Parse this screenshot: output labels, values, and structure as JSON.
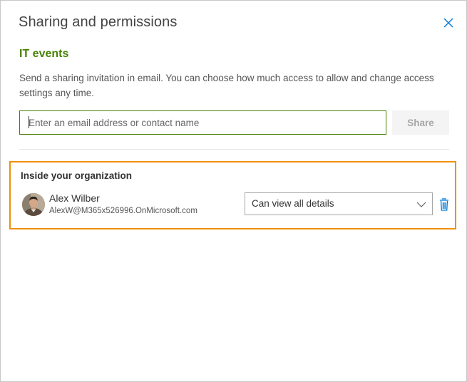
{
  "dialog": {
    "title": "Sharing and permissions",
    "close_icon": "close-icon"
  },
  "calendar": {
    "name": "IT events",
    "description": "Send a sharing invitation in email. You can choose how much access to allow and change access settings any time."
  },
  "invite": {
    "placeholder": "Enter an email address or contact name",
    "share_label": "Share"
  },
  "section": {
    "title": "Inside your organization",
    "highlight_color": "#f0900c"
  },
  "person": {
    "name": "Alex Wilber",
    "email": "AlexW@M365x526996.OnMicrosoft.com",
    "permission": "Can view all details"
  },
  "colors": {
    "accent": "#498205",
    "icon_blue": "#0078d4"
  }
}
